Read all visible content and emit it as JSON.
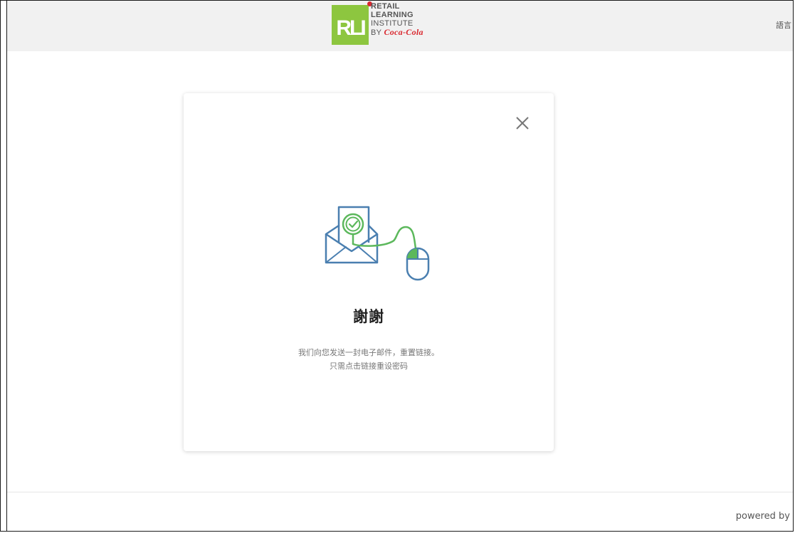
{
  "header": {
    "logo": {
      "badge_text": "RLI",
      "lines": [
        "RETAIL",
        "LEARNING",
        "INSTITUTE"
      ],
      "by_text": "BY",
      "brand_text": "Coca-Cola",
      "badge_color": "#8dc63f",
      "dot_color": "#d9282f"
    },
    "language_label": "語言"
  },
  "dialog": {
    "close_icon": "close-icon",
    "illustration_icon": "email-mouse-icon",
    "title": "謝謝",
    "message_line1": "我们向您发送一封电子邮件，重置链接。",
    "message_line2": "只需点击链接重设密码"
  },
  "footer": {
    "powered_by": "powered by"
  },
  "colors": {
    "accent_green": "#5cb85c",
    "illustration_blue": "#4a7fb0",
    "header_bg": "#f1f1f1"
  }
}
